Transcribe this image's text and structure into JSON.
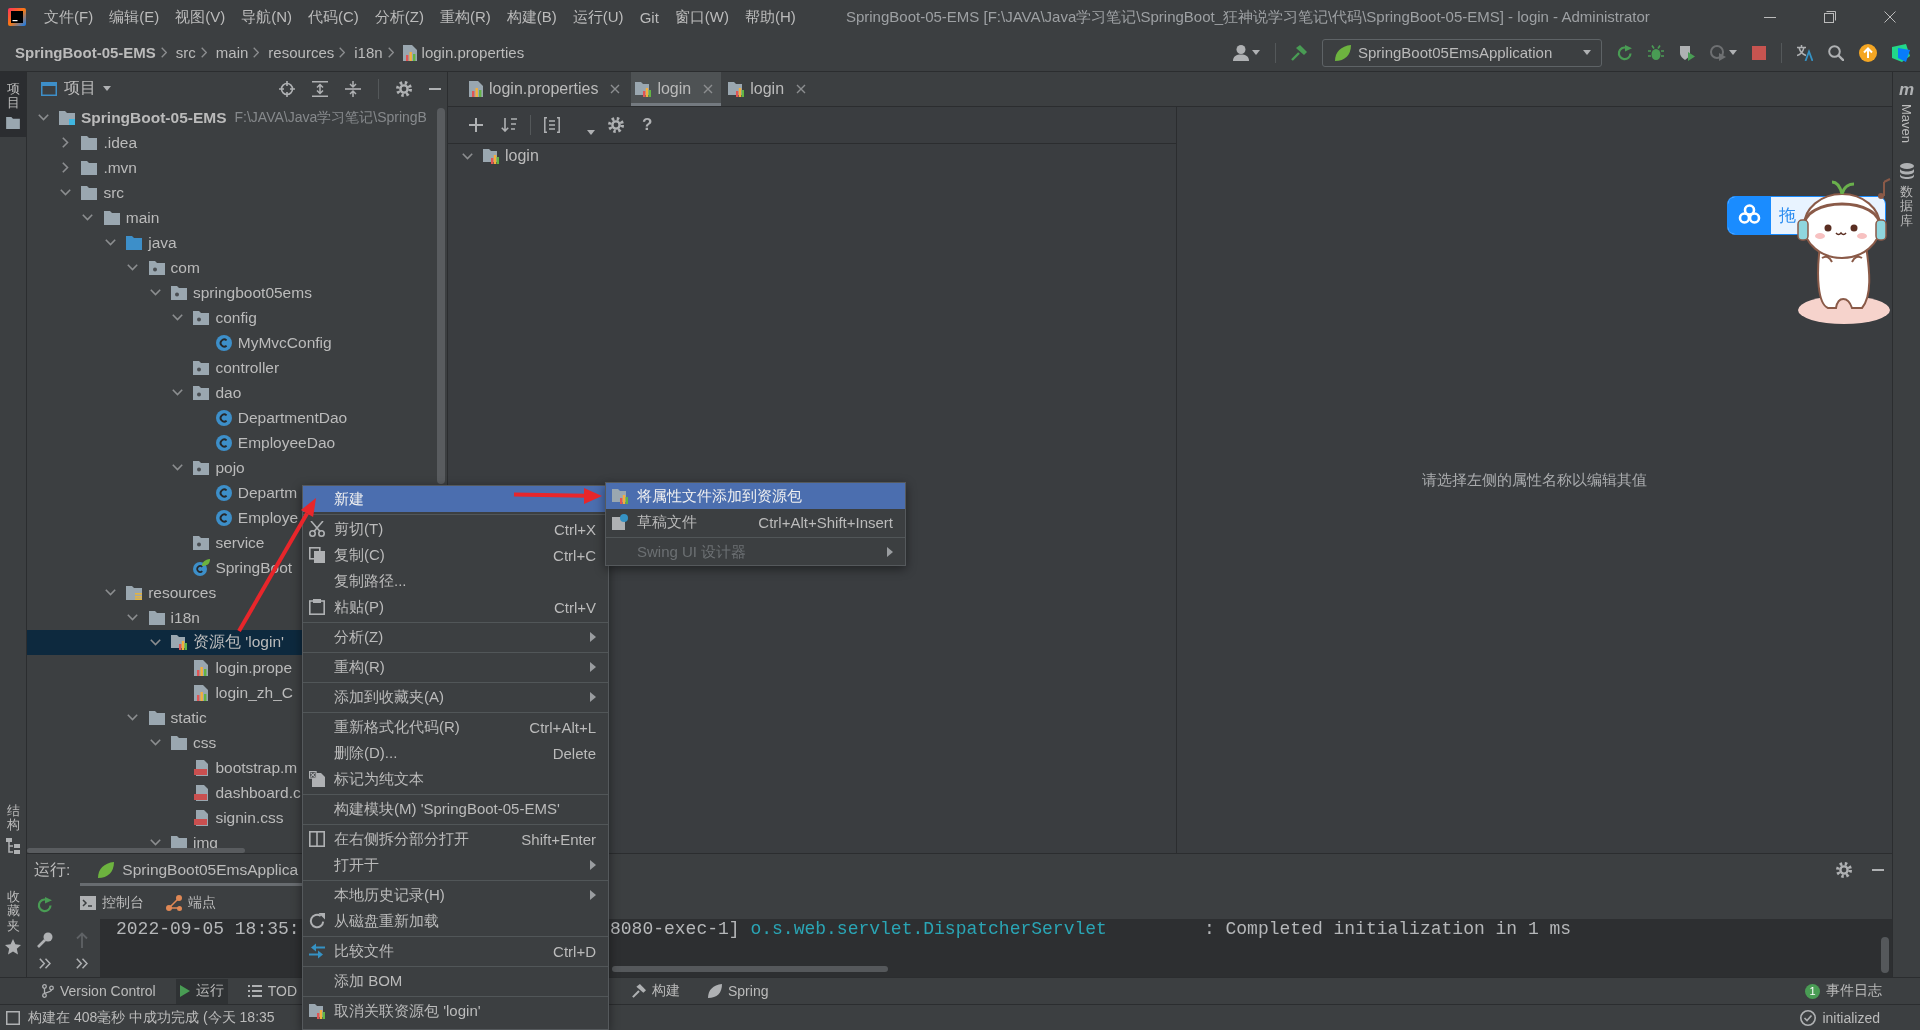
{
  "title_bar": {
    "menus": [
      "文件(F)",
      "编辑(E)",
      "视图(V)",
      "导航(N)",
      "代码(C)",
      "分析(Z)",
      "重构(R)",
      "构建(B)",
      "运行(U)",
      "Git",
      "窗口(W)",
      "帮助(H)"
    ],
    "title": "SpringBoot-05-EMS [F:\\JAVA\\Java学习笔记\\SpringBoot_狂神说学习笔记\\代码\\SpringBoot-05-EMS] - login - Administrator"
  },
  "nav_bar": {
    "breadcrumbs": [
      {
        "label": "SpringBoot-05-EMS",
        "kind": "project"
      },
      {
        "label": "src",
        "kind": "folder"
      },
      {
        "label": "main",
        "kind": "folder"
      },
      {
        "label": "resources",
        "kind": "folder"
      },
      {
        "label": "i18n",
        "kind": "folder"
      },
      {
        "label": "login.properties",
        "kind": "file"
      }
    ],
    "run_config": "SpringBoot05EmsApplication"
  },
  "left_strip": {
    "top": [
      {
        "label": "项目",
        "selected": true
      }
    ],
    "bottom": [
      {
        "label": "结构",
        "selected": false
      },
      {
        "label": "收藏夹",
        "selected": false
      }
    ]
  },
  "project_panel": {
    "title": "项目",
    "tree": [
      {
        "label": "SpringBoot-05-EMS",
        "path": "F:\\JAVA\\Java学习笔记\\SpringB",
        "kind": "module",
        "expanded": true,
        "selected": false,
        "children": [
          {
            "label": ".idea",
            "kind": "folder",
            "expanded": false,
            "selected": false
          },
          {
            "label": ".mvn",
            "kind": "folder",
            "expanded": false,
            "selected": false
          },
          {
            "label": "src",
            "kind": "folder",
            "expanded": true,
            "selected": false,
            "children": [
              {
                "label": "main",
                "kind": "folder",
                "expanded": true,
                "selected": false,
                "children": [
                  {
                    "label": "java",
                    "kind": "source-folder",
                    "expanded": true,
                    "selected": false,
                    "children": [
                      {
                        "label": "com",
                        "kind": "package",
                        "expanded": true,
                        "selected": false,
                        "children": [
                          {
                            "label": "springboot05ems",
                            "kind": "package",
                            "expanded": true,
                            "selected": false,
                            "children": [
                              {
                                "label": "config",
                                "kind": "package",
                                "expanded": true,
                                "selected": false,
                                "children": [
                                  {
                                    "label": "MyMvcConfig",
                                    "kind": "class",
                                    "selected": false
                                  }
                                ]
                              },
                              {
                                "label": "controller",
                                "kind": "package",
                                "selected": false
                              },
                              {
                                "label": "dao",
                                "kind": "package",
                                "expanded": true,
                                "selected": false,
                                "children": [
                                  {
                                    "label": "DepartmentDao",
                                    "kind": "class",
                                    "selected": false
                                  },
                                  {
                                    "label": "EmployeeDao",
                                    "kind": "class",
                                    "selected": false
                                  }
                                ]
                              },
                              {
                                "label": "pojo",
                                "kind": "package",
                                "expanded": true,
                                "selected": false,
                                "children": [
                                  {
                                    "label": "Departm",
                                    "kind": "class",
                                    "selected": false
                                  },
                                  {
                                    "label": "Employe",
                                    "kind": "class",
                                    "selected": false
                                  }
                                ]
                              },
                              {
                                "label": "service",
                                "kind": "package",
                                "selected": false
                              },
                              {
                                "label": "SpringBoot",
                                "kind": "spring-class",
                                "selected": false
                              }
                            ]
                          }
                        ]
                      }
                    ]
                  },
                  {
                    "label": "resources",
                    "kind": "resources-folder",
                    "expanded": true,
                    "selected": false,
                    "children": [
                      {
                        "label": "i18n",
                        "kind": "folder",
                        "expanded": true,
                        "selected": false,
                        "children": [
                          {
                            "label": "资源包 'login'",
                            "kind": "bundle",
                            "expanded": true,
                            "selected": true,
                            "children": [
                              {
                                "label": "login.prope",
                                "kind": "properties",
                                "selected": false
                              },
                              {
                                "label": "login_zh_C",
                                "kind": "properties",
                                "selected": false
                              }
                            ]
                          }
                        ]
                      },
                      {
                        "label": "static",
                        "kind": "folder",
                        "expanded": true,
                        "selected": false,
                        "children": [
                          {
                            "label": "css",
                            "kind": "folder",
                            "expanded": true,
                            "selected": false,
                            "children": [
                              {
                                "label": "bootstrap.m",
                                "kind": "css",
                                "selected": false
                              },
                              {
                                "label": "dashboard.c",
                                "kind": "css",
                                "selected": false
                              },
                              {
                                "label": "signin.css",
                                "kind": "css",
                                "selected": false
                              }
                            ]
                          },
                          {
                            "label": "img",
                            "kind": "folder",
                            "expanded": true,
                            "selected": false
                          }
                        ]
                      }
                    ]
                  }
                ]
              }
            ]
          }
        ]
      }
    ]
  },
  "editor": {
    "tabs": [
      {
        "label": "login.properties",
        "kind": "properties",
        "selected": false
      },
      {
        "label": "login",
        "kind": "bundle",
        "selected": true
      },
      {
        "label": "login",
        "kind": "bundle",
        "selected": false
      }
    ],
    "help": "?",
    "bundle_tree": [
      {
        "label": "login",
        "expanded": true,
        "selected": false
      }
    ],
    "hint": "请选择左侧的属性名称以编辑其值"
  },
  "right_strip": [
    {
      "label": "Maven",
      "glyph": "m",
      "kind": "maven"
    },
    {
      "label": "数据库",
      "kind": "database"
    }
  ],
  "run_panel": {
    "label": "运行:",
    "tabs": [
      {
        "label": "SpringBoot05EmsApplica",
        "selected": true
      }
    ],
    "subtabs": [
      {
        "label": "控制台"
      },
      {
        "label": "端点"
      }
    ],
    "console": [
      {
        "text": "2022-09-05 18:35:",
        "kind": "plain"
      },
      {
        "text": "8080-exec-1]",
        "kind": "plain"
      },
      {
        "text": "o.s.web.servlet.DispatcherServlet",
        "kind": "logger"
      },
      {
        "text": ": Completed initialization in 1 ms",
        "kind": "plain"
      }
    ]
  },
  "tool_window_bar": {
    "tabs": [
      {
        "label": "Version Control",
        "selected": false
      },
      {
        "label": "运行",
        "selected": true
      },
      {
        "label": "TOD",
        "selected": false
      },
      {
        "label": "构建",
        "selected": false
      },
      {
        "label": "Spring",
        "selected": false
      }
    ],
    "event_log": {
      "label": "事件日志",
      "count": "1"
    }
  },
  "status_bar": {
    "message": "构建在 408毫秒 中成功完成 (今天 18:35",
    "status": "initialized"
  },
  "context_menu": {
    "groups": [
      [
        {
          "label": "新建",
          "selected": true,
          "submenu": false
        }
      ],
      [
        {
          "label": "剪切(T)",
          "shortcut": "Ctrl+X",
          "selected": false,
          "submenu": false
        },
        {
          "label": "复制(C)",
          "shortcut": "Ctrl+C",
          "selected": false,
          "submenu": false
        },
        {
          "label": "复制路径...",
          "selected": false,
          "submenu": false
        },
        {
          "label": "粘贴(P)",
          "shortcut": "Ctrl+V",
          "selected": false,
          "submenu": false
        }
      ],
      [
        {
          "label": "分析(Z)",
          "selected": false,
          "submenu": true
        }
      ],
      [
        {
          "label": "重构(R)",
          "selected": false,
          "submenu": true
        }
      ],
      [
        {
          "label": "添加到收藏夹(A)",
          "selected": false,
          "submenu": true
        }
      ],
      [
        {
          "label": "重新格式化代码(R)",
          "shortcut": "Ctrl+Alt+L",
          "selected": false,
          "submenu": false
        },
        {
          "label": "删除(D)...",
          "shortcut": "Delete",
          "selected": false,
          "submenu": false
        },
        {
          "label": "标记为纯文本",
          "selected": false,
          "submenu": false
        }
      ],
      [
        {
          "label": "构建模块(M) 'SpringBoot-05-EMS'",
          "selected": false,
          "submenu": false
        }
      ],
      [
        {
          "label": "在右侧拆分部分打开",
          "shortcut": "Shift+Enter",
          "selected": false,
          "submenu": false
        },
        {
          "label": "打开于",
          "selected": false,
          "submenu": true
        }
      ],
      [
        {
          "label": "本地历史记录(H)",
          "selected": false,
          "submenu": true
        },
        {
          "label": "从磁盘重新加载",
          "selected": false,
          "submenu": false
        }
      ],
      [
        {
          "label": "比较文件",
          "shortcut": "Ctrl+D",
          "selected": false,
          "submenu": false
        }
      ],
      [
        {
          "label": "添加 BOM",
          "selected": false,
          "submenu": false
        }
      ],
      [
        {
          "label": "取消关联资源包 'login'",
          "selected": false,
          "submenu": false
        }
      ]
    ],
    "submenu": {
      "groups": [
        [
          {
            "label": "将属性文件添加到资源包",
            "selected": true,
            "disabled": false,
            "submenu": false
          },
          {
            "label": "草稿文件",
            "shortcut": "Ctrl+Alt+Shift+Insert",
            "selected": false,
            "disabled": false,
            "submenu": false
          }
        ],
        [
          {
            "label": "Swing UI 设计器",
            "selected": false,
            "disabled": true,
            "submenu": true
          }
        ]
      ]
    }
  },
  "floating_widget": {
    "text": "拖"
  }
}
